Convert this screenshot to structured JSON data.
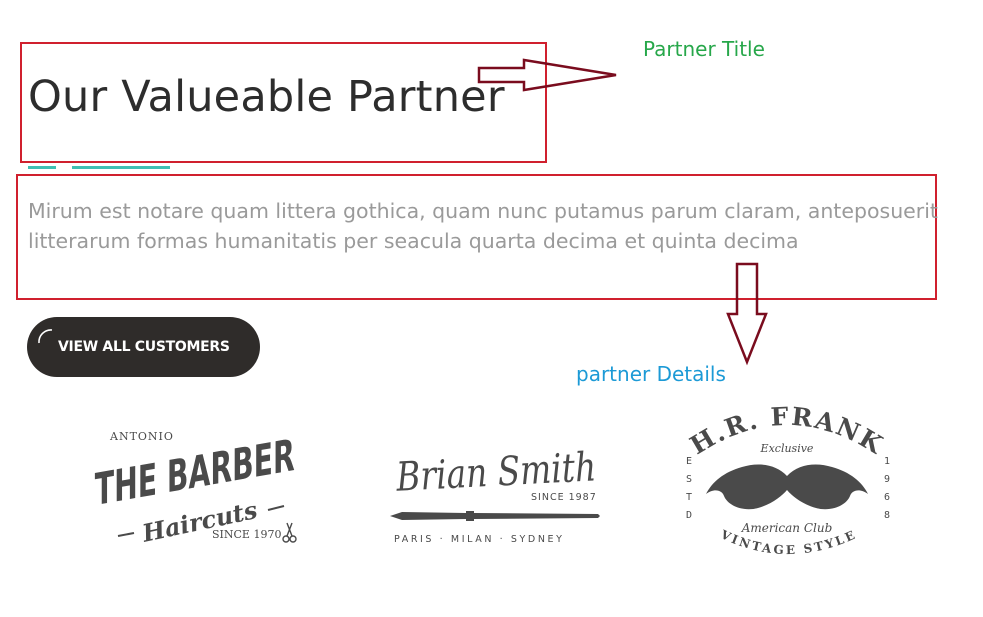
{
  "partner_section": {
    "title": "Our Valueable Partner",
    "description": "Mirum est notare quam littera gothica, quam nunc putamus parum claram, anteposuerit litterarum formas humanitatis per seacula quarta decima et quinta decima",
    "cta_label": "VIEW ALL CUSTOMERS"
  },
  "annotations": {
    "title_label": "Partner Title",
    "details_label": "partner Details",
    "box_color": "#d0202e",
    "arrow_color": "#7a0c1e",
    "title_label_color": "#27a74a",
    "details_label_color": "#1c9ad6"
  },
  "logos": {
    "barber": {
      "top": "ANTONIO",
      "main": "THE BARBER",
      "script": "Haircuts",
      "since": "SINCE 1970",
      "icon": "scissors-icon"
    },
    "brian": {
      "script": "Brian Smith",
      "since": "SINCE 1987",
      "cities": "PARIS · MILAN · SYDNEY",
      "icon": "paintbrush-icon"
    },
    "frank": {
      "arc": "H.R. FRANK",
      "exclusive": "Exclusive",
      "left": [
        "E",
        "S",
        "T",
        "D"
      ],
      "right": [
        "1",
        "9",
        "6",
        "8"
      ],
      "club": "American Club",
      "bottom": "VINTAGE STYLE",
      "icon": "mustache-icon"
    }
  },
  "colors": {
    "accent": "#3fbfb3",
    "button_bg": "#2f2c2a",
    "title": "#2d2d2d",
    "text": "#9a9a9a",
    "logo": "#4a4a4a"
  }
}
